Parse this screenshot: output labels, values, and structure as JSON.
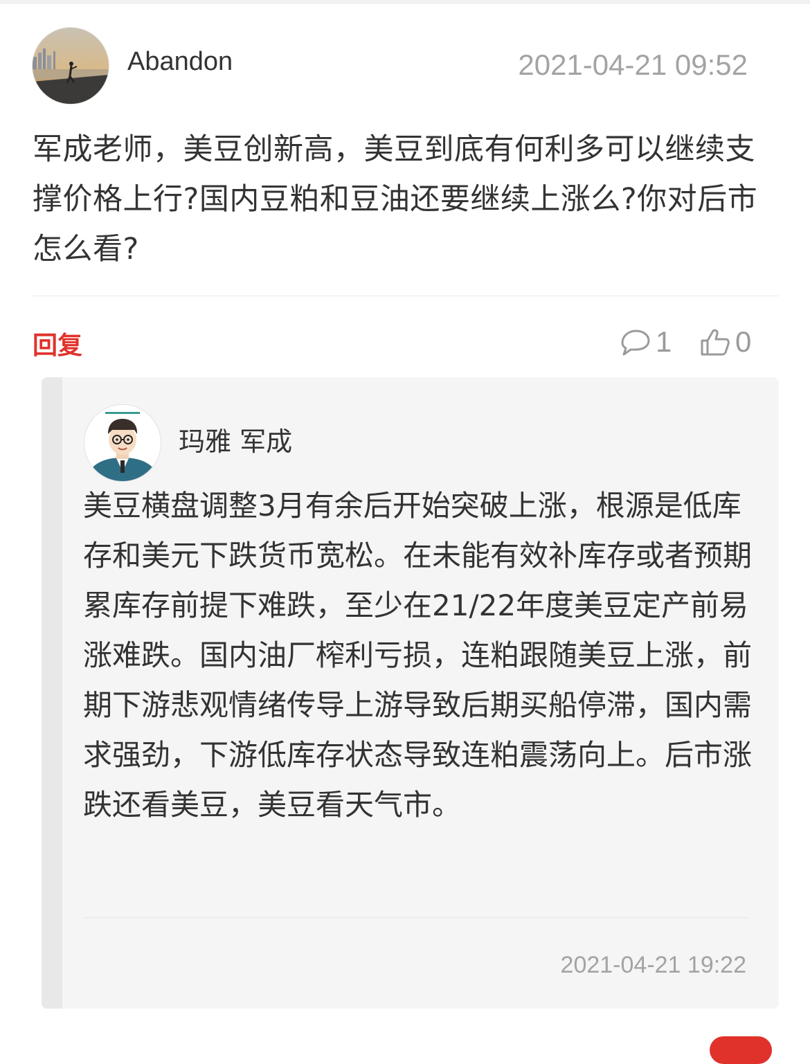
{
  "comment": {
    "user": {
      "name": "Abandon",
      "avatar": "avatar-photo"
    },
    "time": "2021-04-21 09:52",
    "text": "军成老师，美豆创新高，美豆到底有何利多可以继续支撑价格上行?国内豆粕和豆油还要继续上涨么?你对后市怎么看?",
    "actions": {
      "reply_label": "回复",
      "comment_count": "1",
      "like_count": "0",
      "comment_icon": "comment-bubble-icon",
      "like_icon": "thumbs-up-icon"
    }
  },
  "reply": {
    "user": {
      "name": "玛雅 军成",
      "avatar": "avatar-cartoon"
    },
    "text": "美豆横盘调整3月有余后开始突破上涨，根源是低库存和美元下跌货币宽松。在未能有效补库存或者预期累库存前提下难跌，至少在21/22年度美豆定产前易涨难跌。国内油厂榨利亏损，连粕跟随美豆上涨，前期下游悲观情绪传导上游导致后期买船停滞，国内需求强劲，下游低库存状态导致连粕震荡向上。后市涨跌还看美豆，美豆看天气市。",
    "time": "2021-04-21 19:22"
  },
  "colors": {
    "accent": "#e0322b",
    "muted": "#a3a3a3",
    "text": "#333333",
    "card_bg": "#f5f5f5"
  }
}
